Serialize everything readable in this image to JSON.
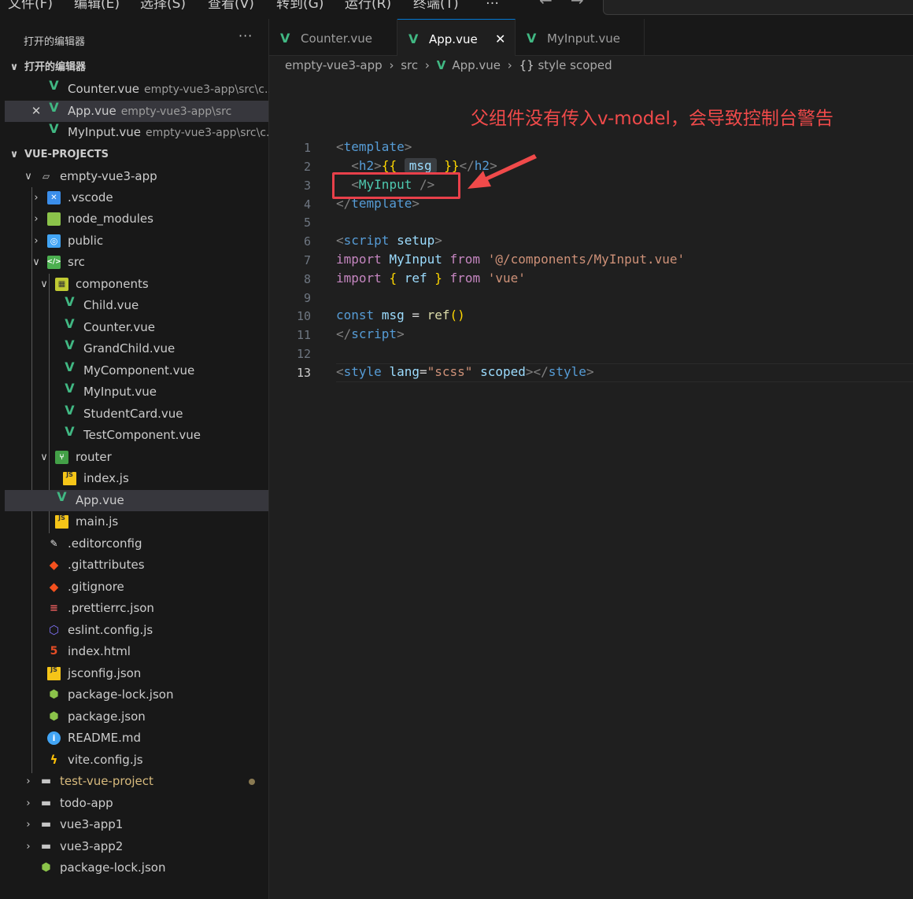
{
  "menubar": {
    "items": [
      "文件(F)",
      "编辑(E)",
      "选择(S)",
      "查看(V)",
      "转到(G)",
      "运行(R)",
      "终端(T)",
      "…"
    ]
  },
  "sidebar": {
    "title": "打开的编辑器",
    "open_editors_head": "打开的编辑器",
    "open_editors": [
      {
        "name": "Counter.vue",
        "path": "empty-vue3-app\\src\\c..."
      },
      {
        "name": "App.vue",
        "path": "empty-vue3-app\\src"
      },
      {
        "name": "MyInput.vue",
        "path": "empty-vue3-app\\src\\c..."
      }
    ],
    "projects_head": "VUE-PROJECTS",
    "tree": {
      "root": "empty-vue3-app",
      "vscode": ".vscode",
      "node_modules": "node_modules",
      "public": "public",
      "src": "src",
      "components": "components",
      "component_files": [
        "Child.vue",
        "Counter.vue",
        "GrandChild.vue",
        "MyComponent.vue",
        "MyInput.vue",
        "StudentCard.vue",
        "TestComponent.vue"
      ],
      "router": "router",
      "router_index": "index.js",
      "app": "App.vue",
      "main": "main.js",
      "root_files": [
        ".editorconfig",
        ".gitattributes",
        ".gitignore",
        ".prettierrc.json",
        "eslint.config.js",
        "index.html",
        "jsconfig.json",
        "package-lock.json",
        "package.json",
        "README.md",
        "vite.config.js"
      ],
      "other_projects": [
        "test-vue-project",
        "todo-app",
        "vue3-app1",
        "vue3-app2"
      ],
      "workspace_file": "package-lock.json"
    }
  },
  "tabs": [
    {
      "label": "Counter.vue",
      "active": false
    },
    {
      "label": "App.vue",
      "active": true,
      "close": "✕"
    },
    {
      "label": "MyInput.vue",
      "active": false
    }
  ],
  "breadcrumb": {
    "parts": [
      "empty-vue3-app",
      "src",
      "App.vue",
      "style scoped"
    ],
    "style_icon": "{}"
  },
  "annotation": "父组件没有传入v-model，会导致控制台警告",
  "editor": {
    "line_numbers": [
      "1",
      "2",
      "3",
      "4",
      "5",
      "6",
      "7",
      "8",
      "9",
      "10",
      "11",
      "12",
      "13"
    ],
    "current_line": "13",
    "tokens": {
      "template": "template",
      "h2": "h2",
      "msg_hint": "msg",
      "myinput": "MyInput",
      "script": "script",
      "setup": "setup",
      "import": "import",
      "from": "from",
      "myinput_path": "'@/components/MyInput.vue'",
      "ref": "ref",
      "vue_str": "'vue'",
      "const": "const",
      "msg": "msg",
      "style": "style",
      "lang": "lang",
      "scss": "\"scss\"",
      "scoped": "scoped"
    }
  },
  "colors": {
    "vue_green": "#41b883",
    "annotation_red": "#f04a4a",
    "active_tab_border": "#0078d4"
  }
}
